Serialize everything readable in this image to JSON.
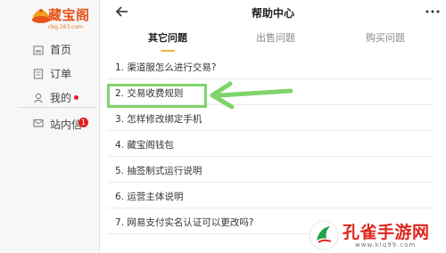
{
  "sidebar": {
    "logo_text": "藏宝阁",
    "logo_sub": "cbg.163.com",
    "items": [
      {
        "label": "首页",
        "icon": "home-icon"
      },
      {
        "label": "订单",
        "icon": "order-icon"
      },
      {
        "label": "我的",
        "icon": "user-icon",
        "dot": true
      }
    ],
    "messages": {
      "label": "站内信",
      "badge": "1",
      "icon": "mail-icon"
    }
  },
  "header": {
    "title": "帮助中心",
    "back_icon": "arrow-left-icon",
    "more_icon": "more-dots-icon"
  },
  "tabs": [
    {
      "label": "其它问题",
      "active": true
    },
    {
      "label": "出售问题",
      "active": false
    },
    {
      "label": "购买问题",
      "active": false
    }
  ],
  "faq": [
    "1. 渠道服怎么进行交易?",
    "2. 交易收费规则",
    "3. 怎样修改绑定手机",
    "4. 藏宝阁钱包",
    "5. 抽签制式运行说明",
    "6. 运营主体说明",
    "7. 网易支付实名认证可以更改吗?"
  ],
  "annotation": {
    "highlighted_item": "2. 交易收费规则",
    "color": "#7ed46b"
  },
  "watermark": {
    "text": "孔雀手游网",
    "url": "www.klq99.com"
  },
  "colors": {
    "accent": "#f0b43c",
    "badge": "#e02020",
    "brand": "#e8541b"
  }
}
